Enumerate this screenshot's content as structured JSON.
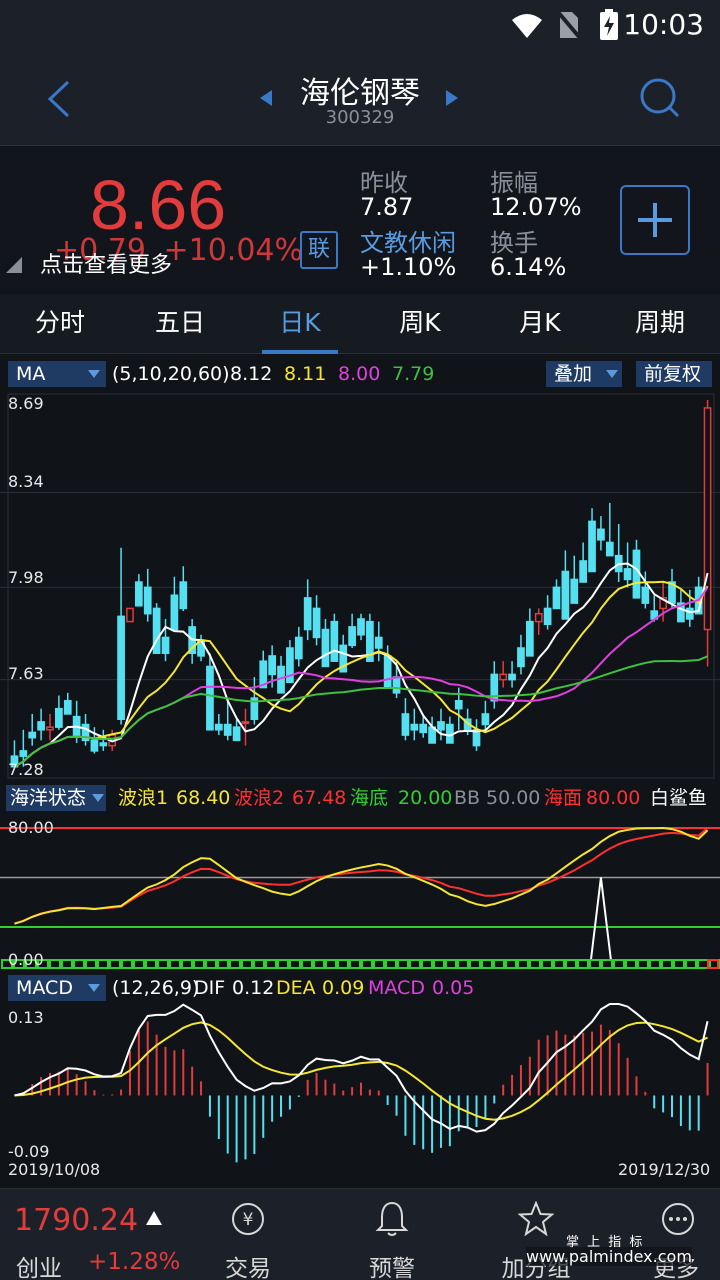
{
  "status_bar": {
    "time": "10:03"
  },
  "header": {
    "title": "海伦钢琴",
    "code": "300329"
  },
  "quote": {
    "price": "8.66",
    "change": "+0.79",
    "change_pct": "+10.04%",
    "more_label": "点击查看更多",
    "lian_label": "联",
    "prev_close_label": "昨收",
    "prev_close": "7.87",
    "sector": "文教休闲",
    "sector_change": "+1.10%",
    "amplitude_label": "振幅",
    "amplitude": "12.07%",
    "turnover_label": "换手",
    "turnover": "6.14%"
  },
  "tabs": [
    {
      "label": "分时"
    },
    {
      "label": "五日"
    },
    {
      "label": "日K"
    },
    {
      "label": "周K"
    },
    {
      "label": "月K"
    },
    {
      "label": "周期"
    }
  ],
  "ma_bar": {
    "selector": "MA",
    "params": "(5,10,20,60)",
    "values": [
      "8.12",
      "8.11",
      "8.00",
      "7.79"
    ],
    "colors": [
      "#ffffff",
      "#f5e634",
      "#e040e0",
      "#40c040"
    ],
    "overlay_label": "叠加",
    "adjust_label": "前复权"
  },
  "price_axis": [
    "8.69",
    "8.34",
    "7.98",
    "7.63",
    "7.28"
  ],
  "ocean_bar": {
    "selector": "海洋状态",
    "items": [
      {
        "label": "波浪1",
        "value": "68.40",
        "label_color": "#f5e634",
        "value_color": "#f5e634"
      },
      {
        "label": "波浪2",
        "value": "67.48",
        "label_color": "#ff3030",
        "value_color": "#ff3030"
      },
      {
        "label": "海底",
        "value": "20.00",
        "label_color": "#30d030",
        "value_color": "#30d030"
      },
      {
        "label": "BB",
        "value": "50.00",
        "label_color": "#8a8f98",
        "value_color": "#8a8f98"
      },
      {
        "label": "海面",
        "value": "80.00",
        "label_color": "#ff3030",
        "value_color": "#ff3030"
      },
      {
        "label": "白鲨鱼",
        "value": "",
        "label_color": "#ffffff",
        "value_color": "#ffffff"
      }
    ],
    "axis_top": "80.00",
    "axis_bottom": "0.00"
  },
  "macd_bar": {
    "selector": "MACD",
    "params": "(12,26,9)",
    "dif_label": "DIF",
    "dif": "0.12",
    "dea_label": "DEA",
    "dea": "0.09",
    "macd_label": "MACD",
    "macd": "0.05",
    "axis_top": "0.13",
    "axis_bottom": "-0.09"
  },
  "dates": {
    "start": "2019/10/08",
    "end": "2019/12/30"
  },
  "bottom_bar": {
    "index_value": "1790.24",
    "index_name": "创业",
    "index_change": "+1.28%",
    "trade_label": "交易",
    "alert_label": "预警",
    "watchlist_label": "加分组",
    "more_label": "更多",
    "watermark_top": "掌 上 指 标",
    "watermark_url": "www.palmindex.com"
  },
  "chart_data": {
    "type": "candlestick",
    "ylim": [
      7.28,
      8.69
    ],
    "candles": [
      [
        7.34,
        7.4,
        7.3,
        7.3
      ],
      [
        7.36,
        7.44,
        7.3,
        7.34
      ],
      [
        7.43,
        7.5,
        7.38,
        7.41
      ],
      [
        7.47,
        7.52,
        7.4,
        7.44
      ],
      [
        7.44,
        7.5,
        7.4,
        7.45
      ],
      [
        7.52,
        7.57,
        7.44,
        7.45
      ],
      [
        7.55,
        7.58,
        7.5,
        7.5
      ],
      [
        7.49,
        7.55,
        7.39,
        7.42
      ],
      [
        7.46,
        7.5,
        7.38,
        7.4
      ],
      [
        7.4,
        7.45,
        7.35,
        7.36
      ],
      [
        7.39,
        7.44,
        7.36,
        7.38
      ],
      [
        7.38,
        7.44,
        7.36,
        7.42
      ],
      [
        7.87,
        8.13,
        7.46,
        7.48
      ],
      [
        7.85,
        7.87,
        7.85,
        7.9
      ],
      [
        8.0,
        8.03,
        7.92,
        7.91
      ],
      [
        7.98,
        8.05,
        7.85,
        7.88
      ],
      [
        7.9,
        7.92,
        7.75,
        7.73
      ],
      [
        7.79,
        7.86,
        7.7,
        7.73
      ],
      [
        7.95,
        8.02,
        7.82,
        7.82
      ],
      [
        8.0,
        8.06,
        7.89,
        7.9
      ],
      [
        7.83,
        7.86,
        7.69,
        7.73
      ],
      [
        7.78,
        7.8,
        7.7,
        7.72
      ],
      [
        7.68,
        7.73,
        7.48,
        7.44
      ],
      [
        7.46,
        7.5,
        7.42,
        7.44
      ],
      [
        7.46,
        7.55,
        7.4,
        7.42
      ],
      [
        7.45,
        7.48,
        7.4,
        7.4
      ],
      [
        7.47,
        7.52,
        7.38,
        7.47
      ],
      [
        7.56,
        7.64,
        7.46,
        7.48
      ],
      [
        7.7,
        7.74,
        7.6,
        7.6
      ],
      [
        7.72,
        7.76,
        7.6,
        7.65
      ],
      [
        7.68,
        7.72,
        7.58,
        7.58
      ],
      [
        7.75,
        7.78,
        7.63,
        7.62
      ],
      [
        7.79,
        7.83,
        7.68,
        7.71
      ],
      [
        7.94,
        8.01,
        7.78,
        7.82
      ],
      [
        7.9,
        7.95,
        7.76,
        7.79
      ],
      [
        7.82,
        7.86,
        7.7,
        7.68
      ],
      [
        7.85,
        7.88,
        7.7,
        7.7
      ],
      [
        7.76,
        7.8,
        7.69,
        7.66
      ],
      [
        7.83,
        7.88,
        7.75,
        7.76
      ],
      [
        7.86,
        7.88,
        7.78,
        7.8
      ],
      [
        7.85,
        7.88,
        7.73,
        7.7
      ],
      [
        7.79,
        7.85,
        7.7,
        7.75
      ],
      [
        7.72,
        7.76,
        7.6,
        7.6
      ],
      [
        7.64,
        7.7,
        7.56,
        7.58
      ],
      [
        7.5,
        7.56,
        7.4,
        7.42
      ],
      [
        7.46,
        7.52,
        7.4,
        7.44
      ],
      [
        7.46,
        7.5,
        7.41,
        7.43
      ],
      [
        7.45,
        7.49,
        7.4,
        7.39
      ],
      [
        7.47,
        7.52,
        7.4,
        7.44
      ],
      [
        7.46,
        7.49,
        7.4,
        7.39
      ],
      [
        7.55,
        7.6,
        7.44,
        7.52
      ],
      [
        7.48,
        7.52,
        7.42,
        7.44
      ],
      [
        7.44,
        7.48,
        7.36,
        7.38
      ],
      [
        7.5,
        7.55,
        7.44,
        7.46
      ],
      [
        7.65,
        7.7,
        7.52,
        7.55
      ],
      [
        7.63,
        7.7,
        7.6,
        7.65
      ],
      [
        7.65,
        7.7,
        7.6,
        7.63
      ],
      [
        7.75,
        7.8,
        7.65,
        7.68
      ],
      [
        7.85,
        7.9,
        7.75,
        7.72
      ],
      [
        7.85,
        7.9,
        7.8,
        7.88
      ],
      [
        7.9,
        7.95,
        7.82,
        7.84
      ],
      [
        7.98,
        8.01,
        7.9,
        7.9
      ],
      [
        8.04,
        8.12,
        7.9,
        7.86
      ],
      [
        8.01,
        8.1,
        7.95,
        7.92
      ],
      [
        8.08,
        8.15,
        8.0,
        8.0
      ],
      [
        8.23,
        8.28,
        8.05,
        8.04
      ],
      [
        8.2,
        8.25,
        8.12,
        8.16
      ],
      [
        8.15,
        8.3,
        8.12,
        8.1
      ],
      [
        8.1,
        8.22,
        8.0,
        8.04
      ],
      [
        8.05,
        8.15,
        7.98,
        8.01
      ],
      [
        8.12,
        8.16,
        8.05,
        7.94
      ],
      [
        7.98,
        8.04,
        7.9,
        7.92
      ],
      [
        7.89,
        7.95,
        7.85,
        7.86
      ],
      [
        7.9,
        8.0,
        7.85,
        7.94
      ],
      [
        8.0,
        8.05,
        7.9,
        7.92
      ],
      [
        7.92,
        7.97,
        7.85,
        7.85
      ],
      [
        7.9,
        7.97,
        7.83,
        7.86
      ],
      [
        7.98,
        8.02,
        7.88,
        7.88
      ],
      [
        7.82,
        8.69,
        7.68,
        8.66
      ]
    ],
    "ocean_ylim": [
      0,
      80
    ],
    "macd_ylim": [
      -0.09,
      0.13
    ]
  }
}
